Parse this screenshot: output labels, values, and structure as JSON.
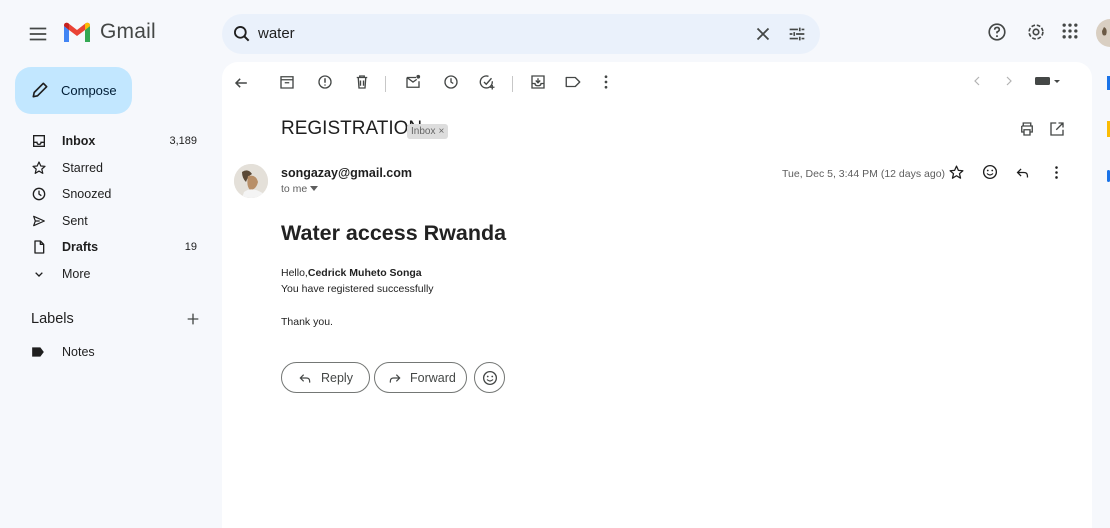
{
  "app": {
    "name": "Gmail"
  },
  "search": {
    "value": "water"
  },
  "compose": {
    "label": "Compose"
  },
  "sidebar": {
    "items": [
      {
        "label": "Inbox",
        "count": "3,189",
        "icon": "inbox-icon",
        "bold": true
      },
      {
        "label": "Starred",
        "count": "",
        "icon": "star-icon",
        "bold": false
      },
      {
        "label": "Snoozed",
        "count": "",
        "icon": "clock-icon",
        "bold": false
      },
      {
        "label": "Sent",
        "count": "",
        "icon": "send-icon",
        "bold": false
      },
      {
        "label": "Drafts",
        "count": "19",
        "icon": "draft-icon",
        "bold": true
      },
      {
        "label": "More",
        "count": "",
        "icon": "chevron-down-icon",
        "bold": false
      }
    ],
    "labels_heading": "Labels",
    "label_items": [
      {
        "label": "Notes",
        "icon": "label-icon"
      }
    ]
  },
  "email": {
    "subject": "REGISTRATION",
    "chip": "Inbox",
    "chip_close": "×",
    "sender": "songazay@gmail.com",
    "recipient": "to me",
    "date": "Tue, Dec 5, 3:44 PM (12 days ago)",
    "title": "Water access Rwanda",
    "greeting_prefix": "Hello,",
    "greeting_name": "Cedrick Muheto Songa",
    "line2": "You have registered successfully",
    "closing": "Thank you."
  },
  "actions": {
    "reply": "Reply",
    "forward": "Forward"
  },
  "colors": {
    "background": "#f6f8fc",
    "compose": "#c2e7ff",
    "search": "#eaf1fb",
    "panel": "#ffffff"
  }
}
